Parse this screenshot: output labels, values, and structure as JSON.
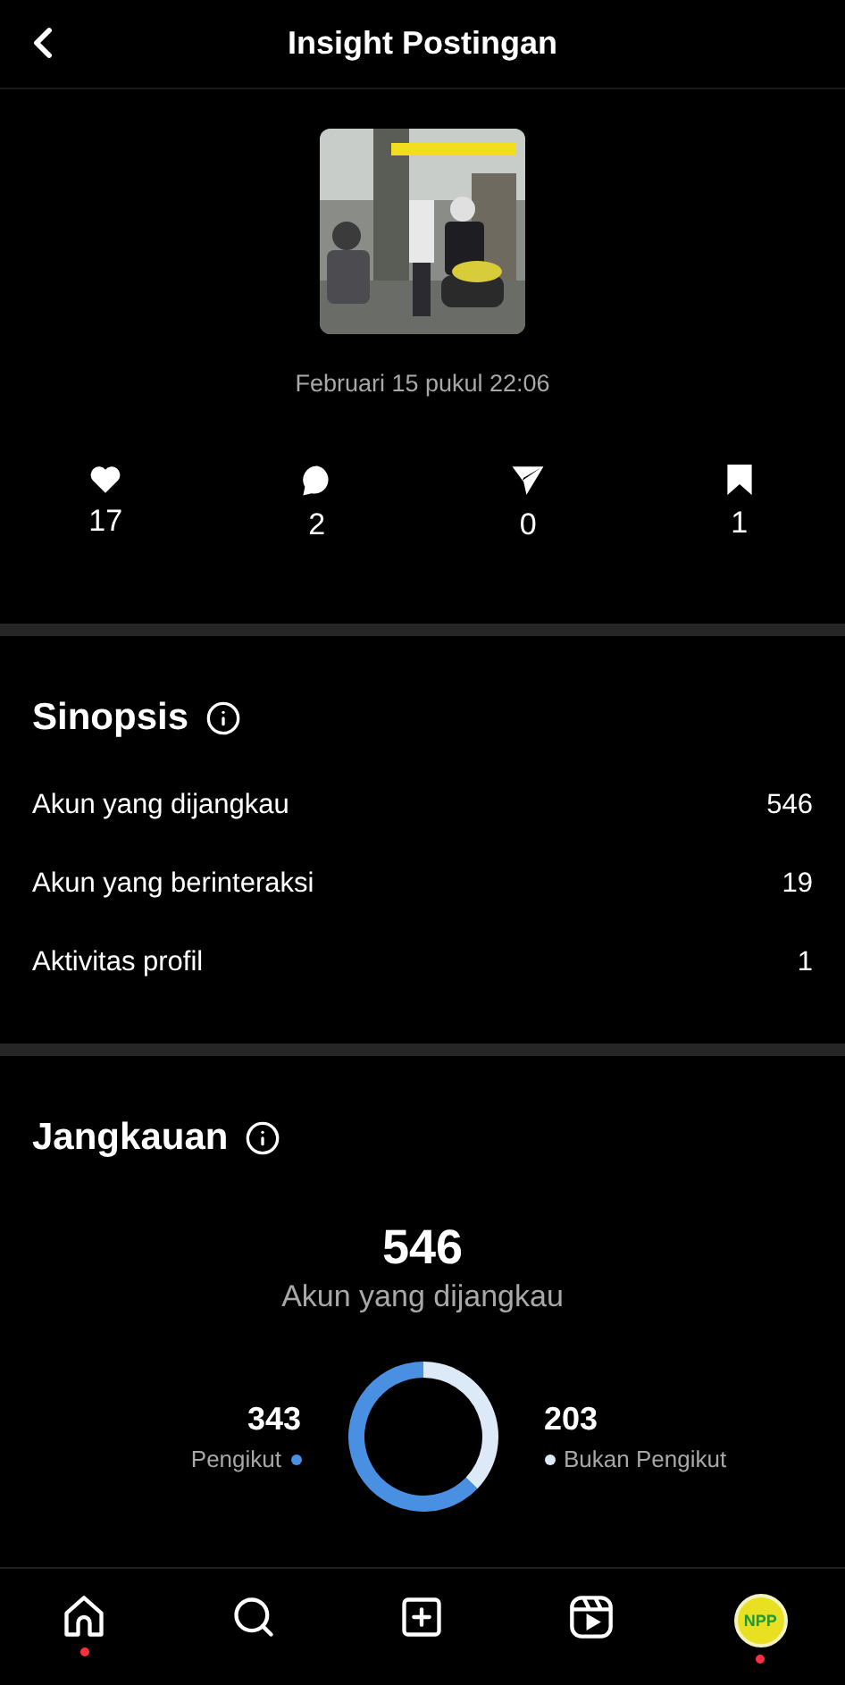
{
  "header": {
    "title": "Insight Postingan"
  },
  "post": {
    "date": "Februari 15 pukul 22:06"
  },
  "stats": [
    {
      "kind": "likes",
      "value": "17"
    },
    {
      "kind": "comments",
      "value": "2"
    },
    {
      "kind": "shares",
      "value": "0"
    },
    {
      "kind": "saves",
      "value": "1"
    }
  ],
  "synopsis": {
    "title": "Sinopsis",
    "rows": [
      {
        "label": "Akun yang dijangkau",
        "value": "546"
      },
      {
        "label": "Akun yang berinteraksi",
        "value": "19"
      },
      {
        "label": "Aktivitas profil",
        "value": "1"
      }
    ]
  },
  "reach": {
    "title": "Jangkauan",
    "total": "546",
    "subtitle": "Akun yang dijangkau",
    "legend": [
      {
        "value": "343",
        "color": "#4a90e2"
      },
      {
        "value": "203",
        "color": "#dceaf8"
      }
    ],
    "chart_data": {
      "type": "donut",
      "categories": [
        "Pengikut",
        "Bukan Pengikut"
      ],
      "values": [
        62.82,
        37.18
      ]
    }
  },
  "nav": [
    {
      "kind": "home",
      "badge": true
    },
    {
      "kind": "search",
      "badge": false
    },
    {
      "kind": "create",
      "badge": false
    },
    {
      "kind": "reels",
      "badge": false
    },
    {
      "kind": "profile",
      "badge": true,
      "avatar_text": "NPP"
    }
  ]
}
